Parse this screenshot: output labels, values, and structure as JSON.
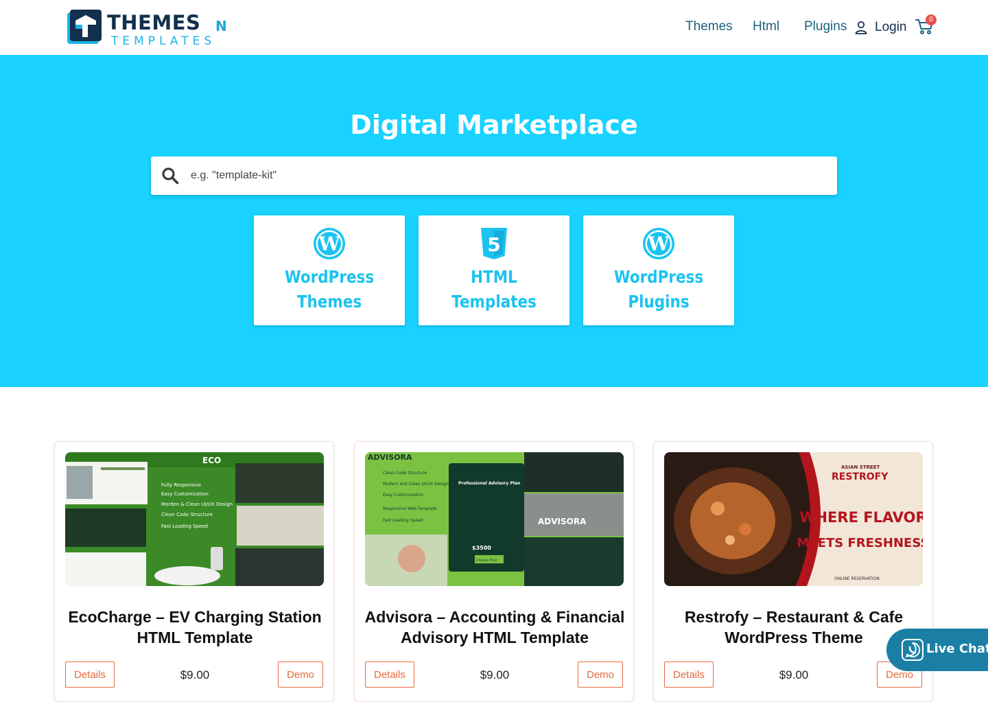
{
  "brand": {
    "name_line1": "THEMES",
    "name_n": "N",
    "name_line2": "TEMPLATES",
    "primary": "#13304d",
    "accent": "#19d2ff"
  },
  "nav": {
    "items": [
      "Themes",
      "Html",
      "Plugins"
    ],
    "login": "Login",
    "cart_count": "0"
  },
  "hero": {
    "title": "Digital Marketplace",
    "search_placeholder": "e.g. \"template-kit\""
  },
  "categories": [
    {
      "line1": "WordPress",
      "line2": "Themes",
      "icon": "wordpress-icon"
    },
    {
      "line1": "HTML",
      "line2": "Templates",
      "icon": "html5-icon"
    },
    {
      "line1": "WordPress",
      "line2": "Plugins",
      "icon": "wordpress-icon"
    }
  ],
  "products": [
    {
      "title_line1": "EcoCharge – EV Charging Station",
      "title_line2": "HTML Template",
      "price": "$9.00",
      "details": "Details",
      "demo": "Demo",
      "thumb": {
        "brand": "ECO",
        "features": [
          "Fully Responsive",
          "Easy Customization",
          "Morden & Clean UI/UX Design",
          "Clean Code Structure",
          "Fast Loading Speed"
        ]
      }
    },
    {
      "title_line1": "Advisora – Accounting & Financial",
      "title_line2": "Advisory HTML Template",
      "price": "$9.00",
      "details": "Details",
      "demo": "Demo",
      "thumb": {
        "brand": "ADVISORA",
        "features": [
          "Clean Code Structure",
          "Modern and Clean UI/UX Design",
          "Easy Customization",
          "Responsive Web Template",
          "Fast Loading Speed"
        ],
        "plan_title": "Professional Advisory Plan",
        "plan_price": "$3500",
        "plan_button": "Choose Plan",
        "overlay": "ADVISORA"
      }
    },
    {
      "title_line1": "Restrofy – Restaurant & Cafe",
      "title_line2": "WordPress Theme",
      "price": "$9.00",
      "details": "Details",
      "demo": "Demo",
      "thumb": {
        "tag": "ASIAN STREET",
        "brand": "RESTROFY",
        "headline_1": "WHERE FLAVOR",
        "headline_2": "MEETS FRESHNESS",
        "footer": "ONLINE RESERVATION"
      }
    }
  ],
  "live_chat": {
    "label": "Live Chat"
  }
}
